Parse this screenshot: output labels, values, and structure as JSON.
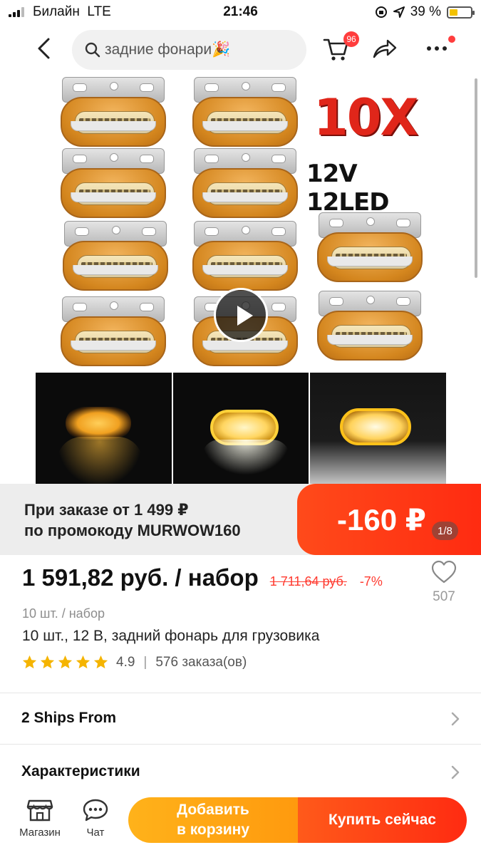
{
  "status_bar": {
    "carrier": "Билайн",
    "network": "LTE",
    "time": "21:46",
    "battery": "39 %",
    "battery_level": 0.39
  },
  "header": {
    "search_query": "задние фонари🎉",
    "cart_count": "96"
  },
  "gallery": {
    "badge_qty": "10X",
    "badge_spec": "12V 12LED",
    "counter": "1/8"
  },
  "promo": {
    "line1": "При заказе от 1 499 ₽",
    "line2": "по промокоду MURWOW160",
    "discount": "-160 ₽"
  },
  "product": {
    "price": "1 591,82 руб. / набор",
    "old_price": "1 711,64 руб.",
    "discount_pct": "-7%",
    "wishlist_count": "507",
    "unit": "10 шт. / набор",
    "title": "10 шт., 12 В, задний фонарь для грузовика",
    "rating": "4.9",
    "stars": 5,
    "orders": "576 заказа(ов)"
  },
  "sections": {
    "ships_from": "2 Ships From",
    "specs": "Характеристики"
  },
  "bottom_bar": {
    "store_label": "Магазин",
    "chat_label": "Чат",
    "add_to_cart_line1": "Добавить",
    "add_to_cart_line2": "в корзину",
    "buy_now": "Купить сейчас"
  },
  "colors": {
    "accent_red": "#ff2b11",
    "accent_orange": "#ff9a0e",
    "price_red": "#ff3b30",
    "star": "#f5b400"
  }
}
